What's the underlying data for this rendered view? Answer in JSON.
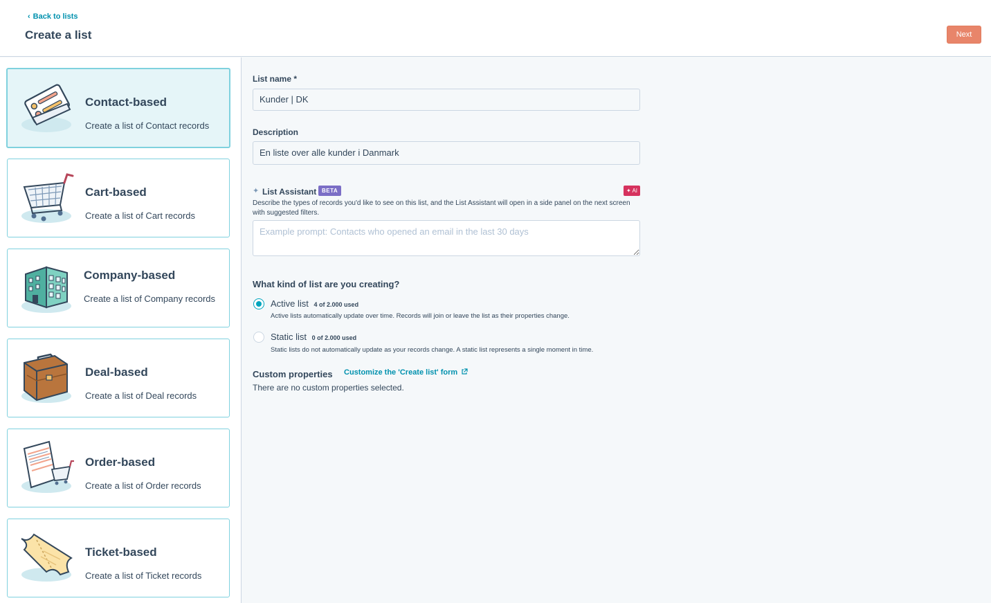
{
  "header": {
    "back_label": "Back to lists",
    "title": "Create a list",
    "next_label": "Next"
  },
  "colors": {
    "accent": "#00a4bd",
    "primary_button": "#e8856a",
    "link": "#0091ae",
    "beta_badge": "#7b6ec6",
    "ai_badge": "#d6325e",
    "selected_card_bg": "#e5f5f8"
  },
  "cards": [
    {
      "title": "Contact-based",
      "description": "Create a list of Contact records",
      "icon": "contact-illustration-icon",
      "selected": true
    },
    {
      "title": "Cart-based",
      "description": "Create a list of Cart records",
      "icon": "cart-illustration-icon",
      "selected": false
    },
    {
      "title": "Company-based",
      "description": "Create a list of Company records",
      "icon": "company-building-illustration-icon",
      "selected": false
    },
    {
      "title": "Deal-based",
      "description": "Create a list of Deal records",
      "icon": "briefcase-illustration-icon",
      "selected": false
    },
    {
      "title": "Order-based",
      "description": "Create a list of Order records",
      "icon": "order-receipt-illustration-icon",
      "selected": false
    },
    {
      "title": "Ticket-based",
      "description": "Create a list of Ticket records",
      "icon": "ticket-illustration-icon",
      "selected": false
    }
  ],
  "form": {
    "list_name_label": "List name *",
    "list_name_value": "Kunder | DK",
    "description_label": "Description",
    "description_value": "En liste over alle kunder i Danmark",
    "assistant_label": "List Assistant",
    "beta_label": "BETA",
    "ai_label": "✦ AI",
    "assistant_help": "Describe the types of records you'd like to see on this list, and the List Assistant will open in a side panel on the next screen with suggested filters.",
    "prompt_placeholder": "Example prompt: Contacts who opened an email in the last 30 days",
    "kind_question": "What kind of list are you creating?",
    "active_label": "Active list",
    "active_count": "4 of 2.000 used",
    "active_help": "Active lists automatically update over time. Records will join or leave the list as their properties change.",
    "active_checked": true,
    "static_label": "Static list",
    "static_count": "0 of 2.000 used",
    "static_help": "Static lists do not automatically update as your records change. A static list represents a single moment in time.",
    "static_checked": false,
    "custom_title": "Custom properties",
    "custom_link": "Customize the 'Create list' form",
    "custom_empty": "There are no custom properties selected."
  }
}
